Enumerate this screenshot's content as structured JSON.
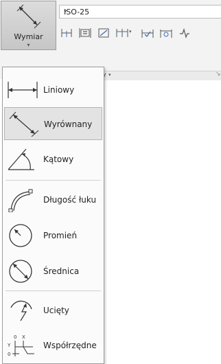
{
  "ribbon": {
    "dimension_button": {
      "label": "Wymiar",
      "arrow": "▾",
      "icon": "aligned-dimension-icon"
    },
    "style_combo": {
      "value": "ISO-25",
      "arrow": "▾"
    },
    "tools": [
      {
        "icon": "baseline-dimension-icon"
      },
      {
        "icon": "text-frame-icon"
      },
      {
        "icon": "quick-dimension-icon"
      },
      {
        "icon": "continue-dimension-icon",
        "has_dropdown": true
      },
      {
        "icon": "adjust-space-icon"
      },
      {
        "icon": "update-dimension-icon"
      },
      {
        "icon": "break-dimension-icon"
      }
    ],
    "panel_label": "miary",
    "panel_arrow": "▾",
    "panel_tail": "↘"
  },
  "menu": {
    "items": [
      {
        "label": "Liniowy",
        "icon": "linear-dimension-icon",
        "selected": false
      },
      {
        "label": "Wyrównany",
        "icon": "aligned-dimension-icon",
        "selected": true
      },
      {
        "label": "Kątowy",
        "icon": "angular-dimension-icon",
        "selected": false
      },
      {
        "label": "Długość łuku",
        "icon": "arc-length-icon",
        "selected": false
      },
      {
        "label": "Promień",
        "icon": "radius-icon",
        "selected": false
      },
      {
        "label": "Średnica",
        "icon": "diameter-icon",
        "selected": false
      },
      {
        "label": "Ucięty",
        "icon": "jogged-dimension-icon",
        "selected": false
      },
      {
        "label": "Współrzędne",
        "icon": "ordinate-dimension-icon",
        "selected": false
      }
    ]
  }
}
